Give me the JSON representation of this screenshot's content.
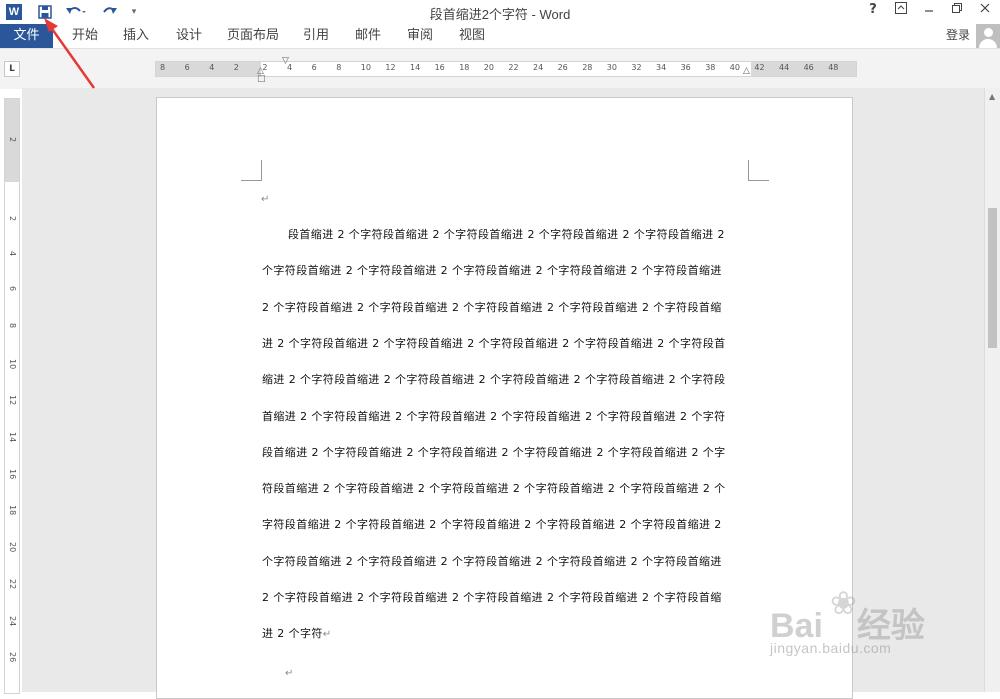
{
  "window": {
    "title": "段首缩进2个字符 - Word",
    "help_label": "?",
    "app_icon_letter": "W"
  },
  "ribbon": {
    "file_tab": "文件",
    "tabs": [
      "开始",
      "插入",
      "设计",
      "页面布局",
      "引用",
      "邮件",
      "审阅",
      "视图"
    ],
    "login_label": "登录"
  },
  "ruler": {
    "horizontal_labels": [
      "8",
      "6",
      "4",
      "2",
      "2",
      "4",
      "6",
      "8",
      "10",
      "12",
      "14",
      "16",
      "18",
      "20",
      "22",
      "24",
      "26",
      "28",
      "30",
      "32",
      "34",
      "36",
      "38",
      "40",
      "42",
      "44",
      "46",
      "48"
    ],
    "vertical_labels": [
      "2",
      "2",
      "4",
      "6",
      "8",
      "10",
      "12",
      "14",
      "16",
      "18",
      "20",
      "22",
      "24",
      "26"
    ],
    "tab_selector": "L"
  },
  "document": {
    "paragraph_mark": "↵",
    "lines": [
      "段首缩进 2 个字符段首缩进 2 个字符段首缩进 2 个字符段首缩进 2 个字符段首缩进 2",
      "个字符段首缩进 2 个字符段首缩进 2 个字符段首缩进 2 个字符段首缩进 2 个字符段首缩进",
      "2 个字符段首缩进 2 个字符段首缩进 2 个字符段首缩进 2 个字符段首缩进 2 个字符段首缩",
      "进 2 个字符段首缩进 2 个字符段首缩进 2 个字符段首缩进 2 个字符段首缩进 2 个字符段首",
      "缩进 2 个字符段首缩进 2 个字符段首缩进 2 个字符段首缩进 2 个字符段首缩进 2 个字符段",
      "首缩进 2 个字符段首缩进 2 个字符段首缩进 2 个字符段首缩进 2 个字符段首缩进 2 个字符",
      "段首缩进 2 个字符段首缩进 2 个字符段首缩进 2 个字符段首缩进 2 个字符段首缩进 2 个字",
      "符段首缩进 2 个字符段首缩进 2 个字符段首缩进 2 个字符段首缩进 2 个字符段首缩进 2 个",
      "字符段首缩进 2 个字符段首缩进 2 个字符段首缩进 2 个字符段首缩进 2 个字符段首缩进 2",
      "个字符段首缩进 2 个字符段首缩进 2 个字符段首缩进 2 个字符段首缩进 2 个字符段首缩进",
      "2 个字符段首缩进 2 个字符段首缩进 2 个字符段首缩进 2 个字符段首缩进 2 个字符段首缩",
      "进 2 个字符"
    ]
  },
  "watermark": {
    "brand": "Bai",
    "brand_tail": "经验",
    "url": "jingyan.baidu.com"
  },
  "colors": {
    "accent": "#2b579a",
    "annotation_arrow": "#e53935"
  }
}
